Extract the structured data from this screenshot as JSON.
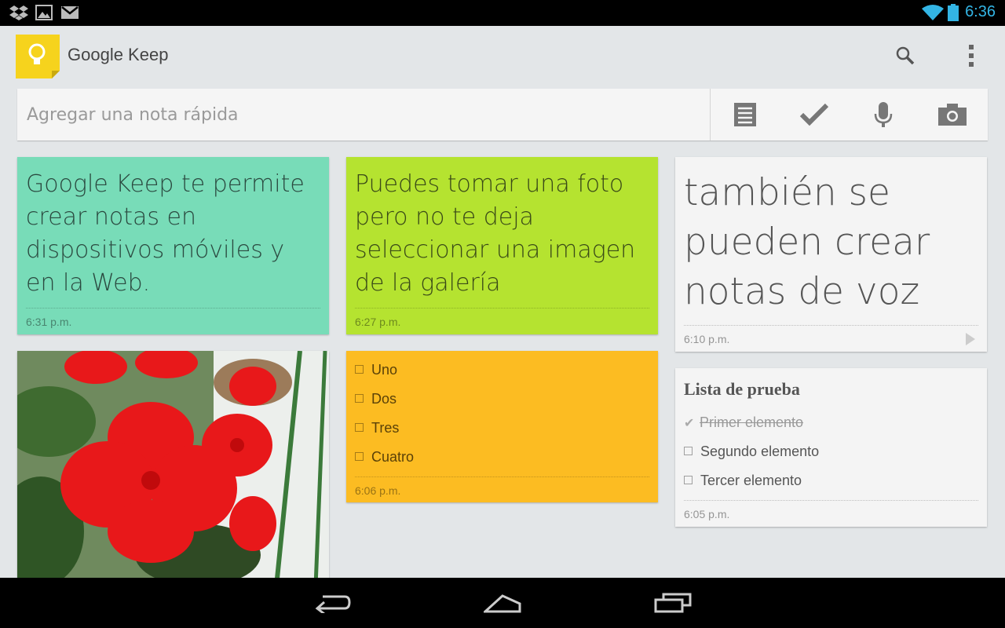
{
  "status_bar": {
    "time": "6:36",
    "icons": [
      "dropbox-icon",
      "image-icon",
      "gmail-icon",
      "wifi-icon",
      "battery-icon"
    ],
    "accent_color": "#33b5e5"
  },
  "action_bar": {
    "title": "Google Keep",
    "icons": [
      "keep-logo-icon",
      "search-icon",
      "overflow-menu-icon"
    ]
  },
  "quick_note": {
    "placeholder": "Agregar una nota rápida",
    "buttons": [
      "text-note-icon",
      "checklist-icon",
      "microphone-icon",
      "camera-icon"
    ]
  },
  "notes": {
    "note1": {
      "text": "Google Keep te permite crear notas en dispositivos móviles y en la Web.",
      "time": "6:31 p.m.",
      "color": "#78dcb8"
    },
    "note2": {
      "text": "Puedes tomar una foto pero no te deja seleccionar una imagen de la galería",
      "time": "6:27 p.m.",
      "color": "#b5e330"
    },
    "note3": {
      "text": "también se pueden crear notas de voz",
      "time": "6:10 p.m.",
      "color": "#f4f4f4",
      "icon": "play-icon"
    },
    "photo": {
      "icon": "red-flower-photo"
    },
    "list1": {
      "items": [
        "Uno",
        "Dos",
        "Tres",
        "Cuatro"
      ],
      "time": "6:06 p.m.",
      "color": "#fcbc22"
    },
    "list2": {
      "title": "Lista de prueba",
      "items": [
        {
          "text": "Primer elemento",
          "checked": true
        },
        {
          "text": "Segundo elemento",
          "checked": false
        },
        {
          "text": "Tercer elemento",
          "checked": false
        }
      ],
      "time": "6:05 p.m.",
      "color": "#f4f4f4"
    }
  },
  "nav_bar": {
    "icons": [
      "back-icon",
      "home-icon",
      "recent-apps-icon"
    ]
  }
}
